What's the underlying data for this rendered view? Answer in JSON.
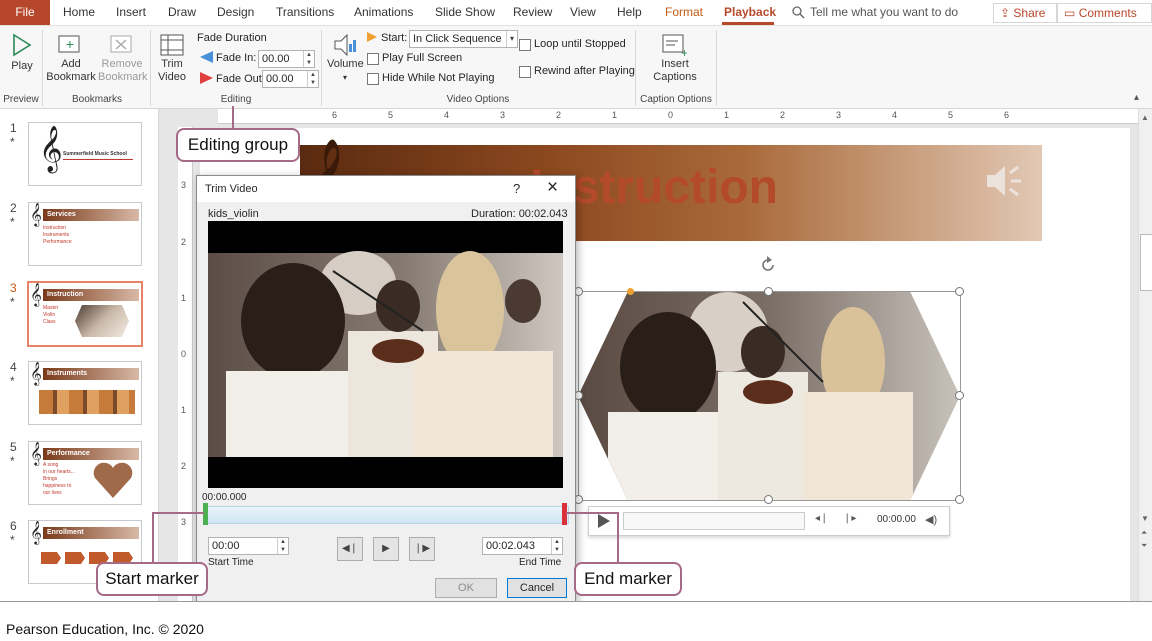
{
  "menu": {
    "file": "File",
    "items": [
      "Home",
      "Insert",
      "Draw",
      "Design",
      "Transitions",
      "Animations",
      "Slide Show",
      "Review",
      "View",
      "Help"
    ],
    "context_items": [
      "Format",
      "Playback"
    ],
    "tell_me": "Tell me what you want to do",
    "share": "Share",
    "comments": "Comments"
  },
  "ribbon": {
    "preview": {
      "play": "Play",
      "group": "Preview"
    },
    "bookmarks": {
      "add": "Add Bookmark",
      "remove": "Remove Bookmark",
      "group": "Bookmarks"
    },
    "editing": {
      "trim": "Trim Video",
      "fade_duration": "Fade Duration",
      "fade_in_label": "Fade In:",
      "fade_in_value": "00.00",
      "fade_out_label": "Fade Out:",
      "fade_out_value": "00.00",
      "group": "Editing"
    },
    "video_options": {
      "volume": "Volume",
      "start_label": "Start:",
      "start_value": "In Click Sequence",
      "play_full_screen": "Play Full Screen",
      "hide_while_not_playing": "Hide While Not Playing",
      "loop_until_stopped": "Loop until Stopped",
      "rewind_after_playing": "Rewind after Playing",
      "group": "Video Options"
    },
    "caption_options": {
      "insert_captions": "Insert Captions",
      "group": "Caption Options"
    }
  },
  "thumbnails": [
    {
      "num": "1",
      "title": "Summerfield Music School"
    },
    {
      "num": "2",
      "title": "Services",
      "lines": [
        "Instruction",
        "Instruments",
        "Performance"
      ]
    },
    {
      "num": "3",
      "title": "Instruction",
      "lines": [
        "Master",
        "Violin",
        "Class"
      ]
    },
    {
      "num": "4",
      "title": "Instruments"
    },
    {
      "num": "5",
      "title": "Performance",
      "lines": [
        "A song",
        "in our hearts...",
        "Brings",
        "happiness to",
        "our lives"
      ]
    },
    {
      "num": "6",
      "title": "Enrollment"
    }
  ],
  "ruler": {
    "h": [
      "6",
      "5",
      "4",
      "3",
      "2",
      "1",
      "0",
      "1",
      "2",
      "3",
      "4",
      "5",
      "6"
    ],
    "v": [
      "3",
      "2",
      "1",
      "0",
      "1",
      "2",
      "3"
    ]
  },
  "slide": {
    "title": "Instruction",
    "player_time": "00:00.00"
  },
  "dialog": {
    "title": "Trim Video",
    "help": "?",
    "close": "×",
    "file_name": "kids_violin",
    "duration": "Duration: 00:02.043",
    "current_time": "00:00.000",
    "start_time_value": "00:00",
    "start_time_label": "Start Time",
    "end_time_value": "00:02.043",
    "end_time_label": "End Time",
    "ok": "OK",
    "cancel": "Cancel"
  },
  "callouts": {
    "editing_group": "Editing group",
    "start_marker": "Start marker",
    "end_marker": "End marker"
  },
  "footer": "Pearson Education, Inc. © 2020"
}
